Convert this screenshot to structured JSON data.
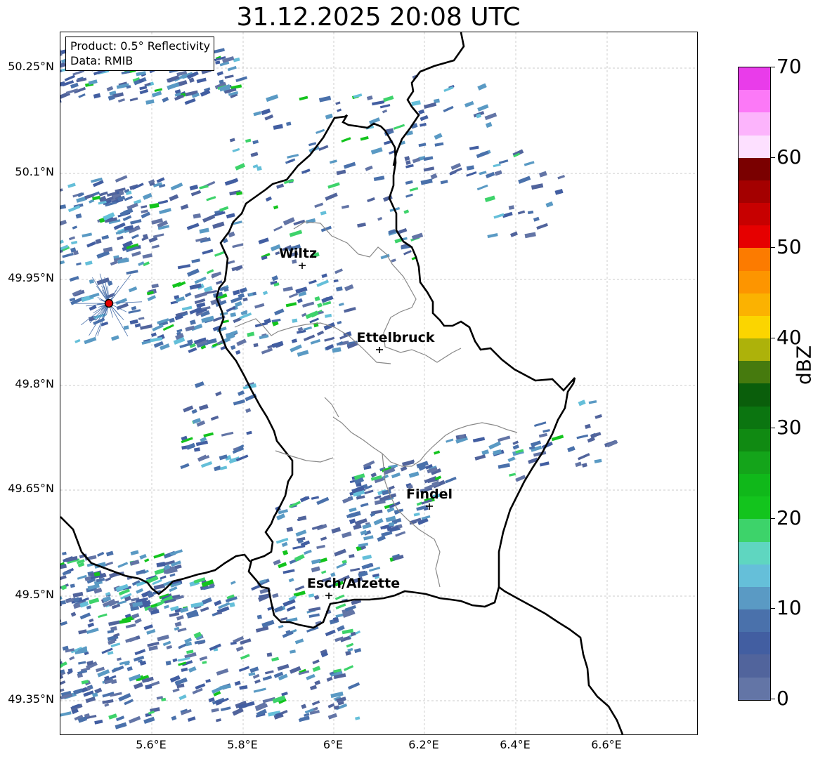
{
  "title": "31.12.2025 20:08 UTC",
  "info": {
    "product": "Product: 0.5° Reflectivity",
    "data": "Data: RMIB"
  },
  "lat_labels": [
    "50.25°N",
    "50.1°N",
    "49.95°N",
    "49.8°N",
    "49.65°N",
    "49.5°N",
    "49.35°N"
  ],
  "lon_labels": [
    "5.6°E",
    "5.8°E",
    "6°E",
    "6.2°E",
    "6.4°E",
    "6.6°E"
  ],
  "cities": [
    {
      "name": "Wiltz"
    },
    {
      "name": "Ettelbruck"
    },
    {
      "name": "Findel"
    },
    {
      "name": "Esch/Alzette"
    }
  ],
  "colorbar": {
    "label": "dBZ",
    "ticks": [
      "0",
      "10",
      "20",
      "30",
      "40",
      "50",
      "60",
      "70"
    ],
    "colors": [
      "#6375a6",
      "#51649c",
      "#425ea1",
      "#4a71ab",
      "#5a9ac4",
      "#65bfd9",
      "#5fd6c0",
      "#3dd36a",
      "#13c41d",
      "#10b81a",
      "#14a41a",
      "#108a12",
      "#0b7510",
      "#0a5e0b",
      "#467a0e",
      "#adb20a",
      "#fbd500",
      "#fbb201",
      "#fd9500",
      "#fc7b00",
      "#e60000",
      "#c70000",
      "#a40000",
      "#7a0000",
      "#fde0ff",
      "#fcb4fc",
      "#fc79f7",
      "#e93cea"
    ]
  }
}
